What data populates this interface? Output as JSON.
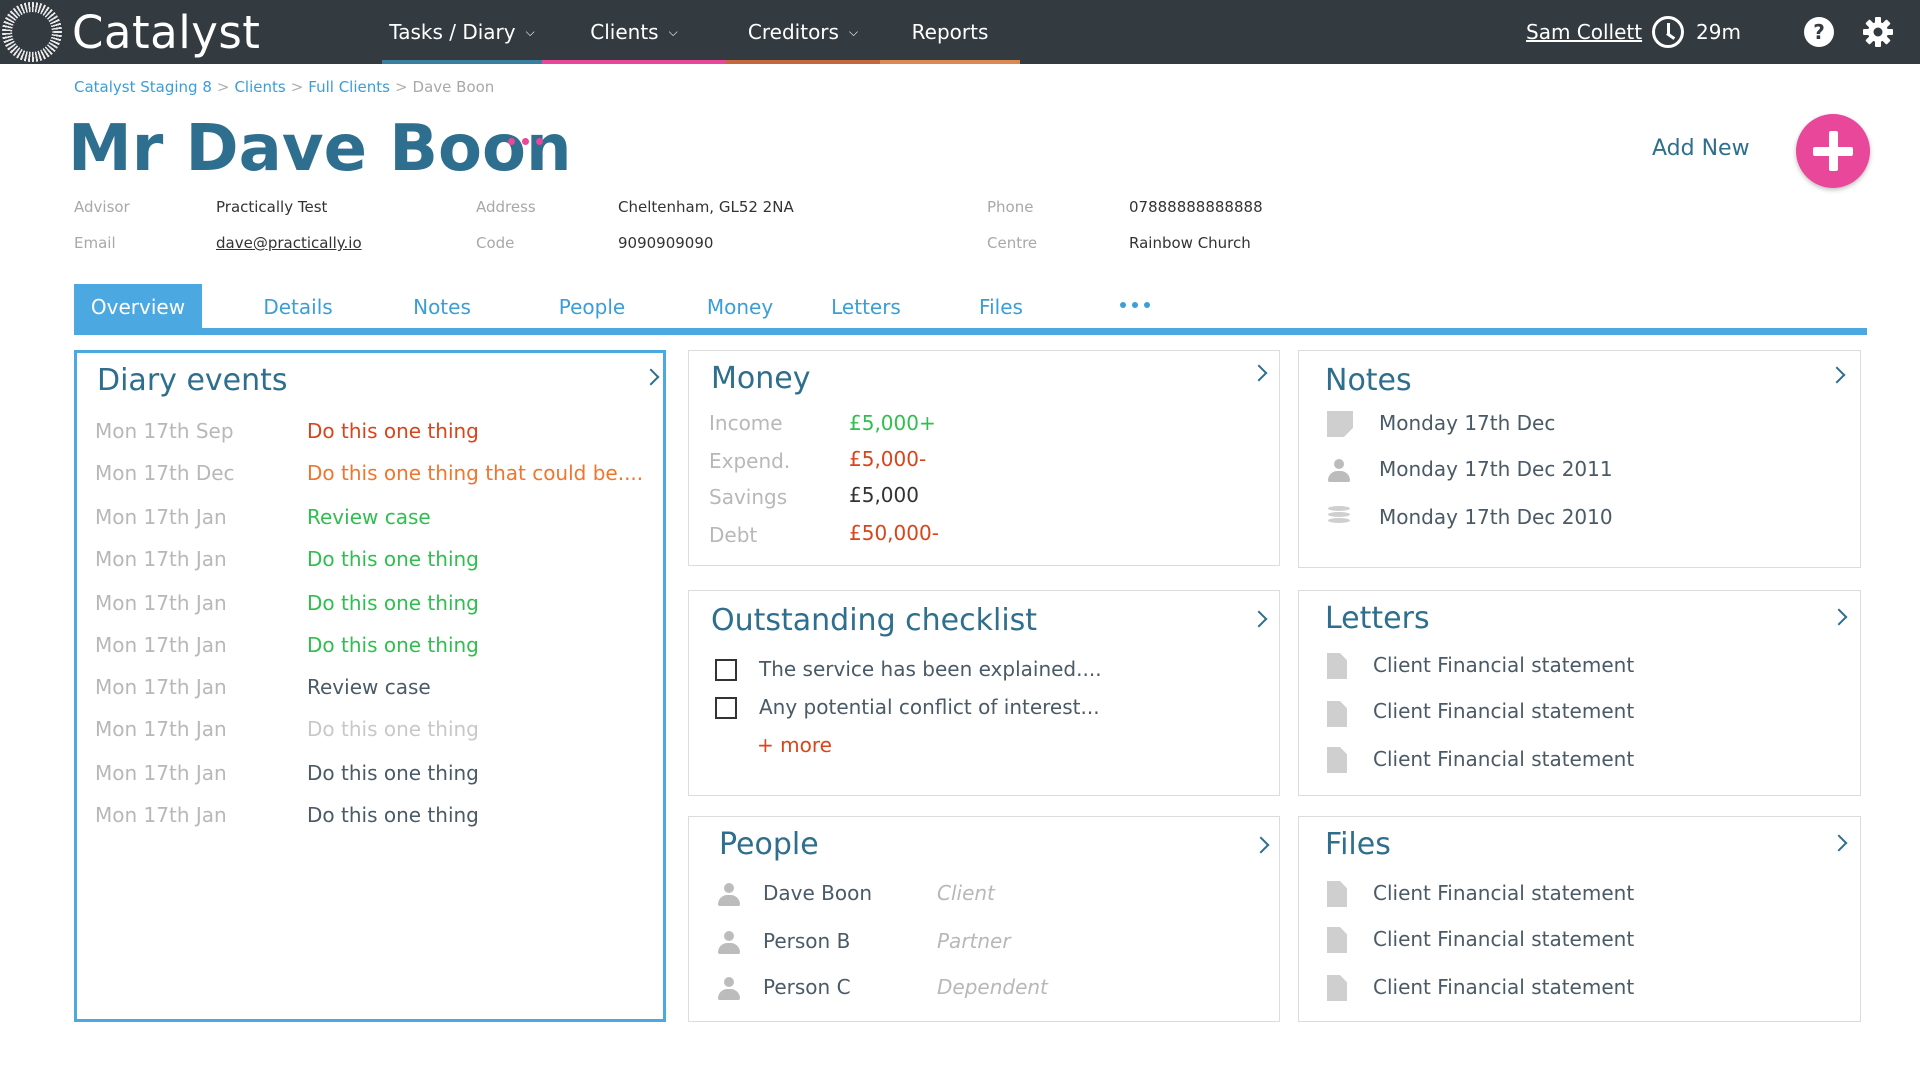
{
  "app": {
    "name": "Catalyst"
  },
  "nav": {
    "items": [
      {
        "label": "Tasks / Diary",
        "chevron": true,
        "underline": "#3a7ea0"
      },
      {
        "label": "Clients",
        "chevron": true,
        "underline": "#e8479a"
      },
      {
        "label": "Creditors",
        "chevron": true,
        "underline": "#c4683e"
      },
      {
        "label": "Reports",
        "chevron": false,
        "underline": "#d88a52"
      }
    ],
    "user": "Sam Collett",
    "timer": "29m",
    "help": "?"
  },
  "breadcrumb": {
    "links": [
      "Catalyst Staging 8",
      "Clients",
      "Full Clients"
    ],
    "separator": ">",
    "current": "Dave Boon"
  },
  "client": {
    "name": "Mr Dave Boon",
    "add_new_label": "Add New",
    "meta": {
      "advisor_label": "Advisor",
      "advisor": "Practically Test",
      "email_label": "Email",
      "email": "dave@practically.io",
      "address_label": "Address",
      "address": "Cheltenham, GL52 2NA",
      "code_label": "Code",
      "code": "9090909090",
      "phone_label": "Phone",
      "phone": "07888888888888",
      "centre_label": "Centre",
      "centre": "Rainbow Church"
    }
  },
  "tabs": [
    "Overview",
    "Details",
    "Notes",
    "People",
    "Money",
    "Letters",
    "Files"
  ],
  "diary": {
    "title": "Diary events",
    "events": [
      {
        "date": "Mon 17th Sep",
        "text": "Do this one thing",
        "tone": "red"
      },
      {
        "date": "Mon 17th Dec",
        "text": "Do this one thing that could be....",
        "tone": "orange"
      },
      {
        "date": "Mon 17th Jan",
        "text": "Review case",
        "tone": "green"
      },
      {
        "date": "Mon 17th Jan",
        "text": "Do this one thing",
        "tone": "green"
      },
      {
        "date": "Mon 17th Jan",
        "text": "Do this one thing",
        "tone": "green"
      },
      {
        "date": "Mon 17th Jan",
        "text": "Do this one thing",
        "tone": "green"
      },
      {
        "date": "Mon 17th Jan",
        "text": "Review case",
        "tone": "dark"
      },
      {
        "date": "Mon 17th Jan",
        "text": "Do this one thing",
        "tone": "muted"
      },
      {
        "date": "Mon 17th Jan",
        "text": "Do this one thing",
        "tone": "dark"
      },
      {
        "date": "Mon 17th Jan",
        "text": "Do this one thing",
        "tone": "dark"
      }
    ]
  },
  "money": {
    "title": "Money",
    "rows": [
      {
        "label": "Income",
        "value": "£5,000+",
        "tone": "green"
      },
      {
        "label": "Expend.",
        "value": "£5,000-",
        "tone": "red"
      },
      {
        "label": "Savings",
        "value": "£5,000",
        "tone": "black"
      },
      {
        "label": "Debt",
        "value": "£50,000-",
        "tone": "red"
      }
    ]
  },
  "notes": {
    "title": "Notes",
    "items": [
      {
        "icon": "note-icon",
        "text": "Monday 17th Dec"
      },
      {
        "icon": "person-icon",
        "text": "Monday 17th Dec 2011"
      },
      {
        "icon": "coins-icon",
        "text": "Monday 17th Dec 2010"
      }
    ]
  },
  "checklist": {
    "title": "Outstanding checklist",
    "items": [
      "The service has been explained....",
      "Any potential conflict of interest..."
    ],
    "more": "+ more"
  },
  "letters": {
    "title": "Letters",
    "items": [
      "Client Financial statement",
      "Client Financial statement",
      "Client Financial statement"
    ]
  },
  "people": {
    "title": "People",
    "items": [
      {
        "name": "Dave Boon",
        "role": "Client"
      },
      {
        "name": "Person B",
        "role": "Partner"
      },
      {
        "name": "Person C",
        "role": "Dependent"
      }
    ]
  },
  "files": {
    "title": "Files",
    "items": [
      "Client Financial statement",
      "Client Financial statement",
      "Client Financial statement"
    ]
  },
  "colors": {
    "topbar": "#333b40",
    "accent_blue": "#4ca8e0",
    "title_blue": "#2e6e8e",
    "pink": "#e8479a"
  }
}
